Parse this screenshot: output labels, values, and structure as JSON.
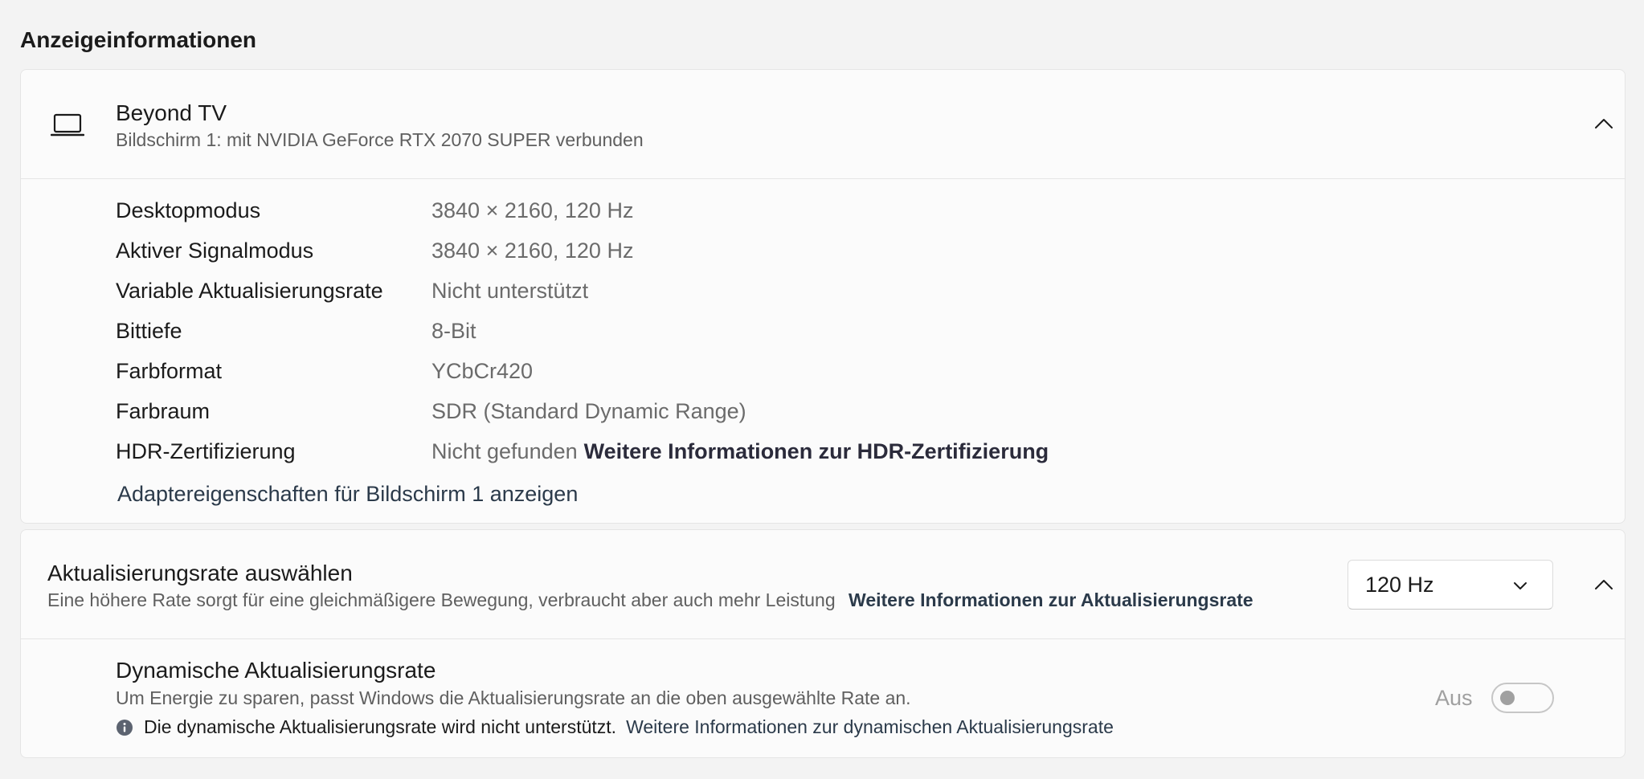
{
  "section": {
    "title": "Anzeigeinformationen"
  },
  "display": {
    "name": "Beyond TV",
    "subtitle": "Bildschirm 1: mit NVIDIA GeForce RTX 2070 SUPER verbunden",
    "icon": "laptop-icon",
    "expanded": true,
    "rows": [
      {
        "label": "Desktopmodus",
        "value": "3840 × 2160, 120 Hz"
      },
      {
        "label": "Aktiver Signalmodus",
        "value": "3840 × 2160, 120 Hz"
      },
      {
        "label": "Variable Aktualisierungsrate",
        "value": "Nicht unterstützt"
      },
      {
        "label": "Bittiefe",
        "value": "8-Bit"
      },
      {
        "label": "Farbformat",
        "value": "YCbCr420"
      },
      {
        "label": "Farbraum",
        "value": "SDR (Standard Dynamic Range)"
      },
      {
        "label": "HDR-Zertifizierung",
        "value": "Nicht gefunden",
        "link": "Weitere Informationen zur HDR-Zertifizierung"
      }
    ],
    "adapter_link": "Adaptereigenschaften für Bildschirm 1 anzeigen"
  },
  "refresh": {
    "title": "Aktualisierungsrate auswählen",
    "subtitle": "Eine höhere Rate sorgt für eine gleichmäßigere Bewegung, verbraucht aber auch mehr Leistung",
    "link": "Weitere Informationen zur Aktualisierungsrate",
    "selected": "120 Hz",
    "expanded": true
  },
  "dynamic": {
    "title": "Dynamische Aktualisierungsrate",
    "subtitle": "Um Energie zu sparen, passt Windows die Aktualisierungsrate an die oben ausgewählte Rate an.",
    "note": "Die dynamische Aktualisierungsrate wird nicht unterstützt.",
    "note_link": "Weitere Informationen zur dynamischen Aktualisierungsrate",
    "toggle_label": "Aus",
    "toggle_on": false,
    "toggle_disabled": true
  },
  "colors": {
    "background": "#f3f3f3",
    "card": "#fbfbfb",
    "border": "#e5e5e5",
    "secondary_text": "#5f5f5f",
    "info_icon": "#5c6370"
  }
}
